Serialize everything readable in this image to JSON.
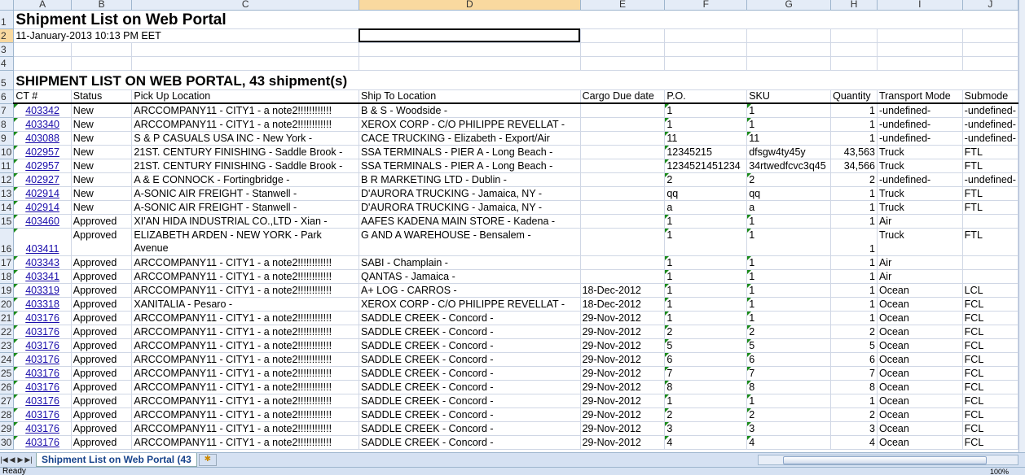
{
  "columns": [
    "A",
    "B",
    "C",
    "D",
    "E",
    "F",
    "G",
    "H",
    "I",
    "J"
  ],
  "selected_col": "D",
  "selected_row": 2,
  "title": "Shipment List on Web Portal",
  "timestamp": "11-January-2013 10:13 PM EET",
  "list_heading": "SHIPMENT LIST ON WEB PORTAL, 43 shipment(s)",
  "headers": [
    "CT #",
    "Status",
    "Pick Up Location",
    "Ship To Location",
    "Cargo Due date",
    "P.O.",
    "SKU",
    "Quantity",
    "Transport Mode",
    "Submode"
  ],
  "rows": [
    [
      "403342",
      "New",
      "ARCCOMPANY11 - CITY1 - a note2!!!!!!!!!!!!",
      "B & S - Woodside -",
      "",
      "1",
      "1",
      "1",
      "-undefined-",
      "-undefined-"
    ],
    [
      "403340",
      "New",
      "ARCCOMPANY11 - CITY1 - a note2!!!!!!!!!!!!",
      "XEROX CORP - C/O PHILIPPE REVELLAT -",
      "",
      "1",
      "1",
      "1",
      "-undefined-",
      "-undefined-"
    ],
    [
      "403088",
      "New",
      "S & P CASUALS USA INC - New York -",
      "CACE TRUCKING - Elizabeth - Export/Air",
      "",
      "11",
      "11",
      "1",
      "-undefined-",
      "-undefined-"
    ],
    [
      "402957",
      "New",
      "21ST. CENTURY FINISHING - Saddle Brook -",
      "SSA TERMINALS - PIER A - Long Beach -",
      "",
      "12345215",
      "dfsgw4ty45y",
      "43,563",
      "Truck",
      "FTL"
    ],
    [
      "402957",
      "New",
      "21ST. CENTURY FINISHING - Saddle Brook -",
      "SSA TERMINALS - PIER A - Long Beach -",
      "",
      "1234521451234",
      "34rtwedfcvc3q45",
      "34,566",
      "Truck",
      "FTL"
    ],
    [
      "402927",
      "New",
      "A & E CONNOCK - Fortingbridge -",
      "B R MARKETING LTD - Dublin -",
      "",
      "2",
      "2",
      "2",
      "-undefined-",
      "-undefined-"
    ],
    [
      "402914",
      "New",
      "A-SONIC AIR FREIGHT - Stanwell -",
      "D'AURORA TRUCKING - Jamaica, NY -",
      "",
      "qq",
      "qq",
      "1",
      "Truck",
      "FTL"
    ],
    [
      "402914",
      "New",
      "A-SONIC AIR FREIGHT - Stanwell -",
      "D'AURORA TRUCKING - Jamaica, NY -",
      "",
      "a",
      "a",
      "1",
      "Truck",
      "FTL"
    ],
    [
      "403460",
      "Approved",
      "XI'AN HIDA INDUSTRIAL CO.,LTD - Xian -",
      "AAFES KADENA MAIN STORE - Kadena -",
      "",
      "1",
      "1",
      "1",
      "Air",
      ""
    ],
    [
      "403411",
      "Approved",
      "ELIZABETH ARDEN - NEW YORK - Park Avenue",
      "G AND A WAREHOUSE - Bensalem -",
      "",
      "1",
      "1",
      "1",
      "Truck",
      "FTL"
    ],
    [
      "403343",
      "Approved",
      "ARCCOMPANY11 - CITY1 - a note2!!!!!!!!!!!!",
      "SABI - Champlain -",
      "",
      "1",
      "1",
      "1",
      "Air",
      ""
    ],
    [
      "403341",
      "Approved",
      "ARCCOMPANY11 - CITY1 - a note2!!!!!!!!!!!!",
      "QANTAS - Jamaica -",
      "",
      "1",
      "1",
      "1",
      "Air",
      ""
    ],
    [
      "403319",
      "Approved",
      "ARCCOMPANY11 - CITY1 - a note2!!!!!!!!!!!!",
      "A+ LOG - CARROS -",
      "18-Dec-2012",
      "1",
      "1",
      "1",
      "Ocean",
      "LCL"
    ],
    [
      "403318",
      "Approved",
      "XANITALIA - Pesaro -",
      "XEROX CORP - C/O PHILIPPE REVELLAT -",
      "18-Dec-2012",
      "1",
      "1",
      "1",
      "Ocean",
      "FCL"
    ],
    [
      "403176",
      "Approved",
      "ARCCOMPANY11 - CITY1 - a note2!!!!!!!!!!!!",
      "SADDLE CREEK - Concord -",
      "29-Nov-2012",
      "1",
      "1",
      "1",
      "Ocean",
      "FCL"
    ],
    [
      "403176",
      "Approved",
      "ARCCOMPANY11 - CITY1 - a note2!!!!!!!!!!!!",
      "SADDLE CREEK - Concord -",
      "29-Nov-2012",
      "2",
      "2",
      "2",
      "Ocean",
      "FCL"
    ],
    [
      "403176",
      "Approved",
      "ARCCOMPANY11 - CITY1 - a note2!!!!!!!!!!!!",
      "SADDLE CREEK - Concord -",
      "29-Nov-2012",
      "5",
      "5",
      "5",
      "Ocean",
      "FCL"
    ],
    [
      "403176",
      "Approved",
      "ARCCOMPANY11 - CITY1 - a note2!!!!!!!!!!!!",
      "SADDLE CREEK - Concord -",
      "29-Nov-2012",
      "6",
      "6",
      "6",
      "Ocean",
      "FCL"
    ],
    [
      "403176",
      "Approved",
      "ARCCOMPANY11 - CITY1 - a note2!!!!!!!!!!!!",
      "SADDLE CREEK - Concord -",
      "29-Nov-2012",
      "7",
      "7",
      "7",
      "Ocean",
      "FCL"
    ],
    [
      "403176",
      "Approved",
      "ARCCOMPANY11 - CITY1 - a note2!!!!!!!!!!!!",
      "SADDLE CREEK - Concord -",
      "29-Nov-2012",
      "8",
      "8",
      "8",
      "Ocean",
      "FCL"
    ],
    [
      "403176",
      "Approved",
      "ARCCOMPANY11 - CITY1 - a note2!!!!!!!!!!!!",
      "SADDLE CREEK - Concord -",
      "29-Nov-2012",
      "1",
      "1",
      "1",
      "Ocean",
      "FCL"
    ],
    [
      "403176",
      "Approved",
      "ARCCOMPANY11 - CITY1 - a note2!!!!!!!!!!!!",
      "SADDLE CREEK - Concord -",
      "29-Nov-2012",
      "2",
      "2",
      "2",
      "Ocean",
      "FCL"
    ],
    [
      "403176",
      "Approved",
      "ARCCOMPANY11 - CITY1 - a note2!!!!!!!!!!!!",
      "SADDLE CREEK - Concord -",
      "29-Nov-2012",
      "3",
      "3",
      "3",
      "Ocean",
      "FCL"
    ],
    [
      "403176",
      "Approved",
      "ARCCOMPANY11 - CITY1 - a note2!!!!!!!!!!!!",
      "SADDLE CREEK - Concord -",
      "29-Nov-2012",
      "4",
      "4",
      "4",
      "Ocean",
      "FCL"
    ]
  ],
  "sheet_tab": "Shipment List on Web Portal (43",
  "status_text": "Ready",
  "zoom_level": "100%",
  "colors": {
    "link": "#1a0dab",
    "header_bg": "#e4ecf7",
    "selected_header": "#f9d99f",
    "error_triangle": "#1a8a1a"
  }
}
